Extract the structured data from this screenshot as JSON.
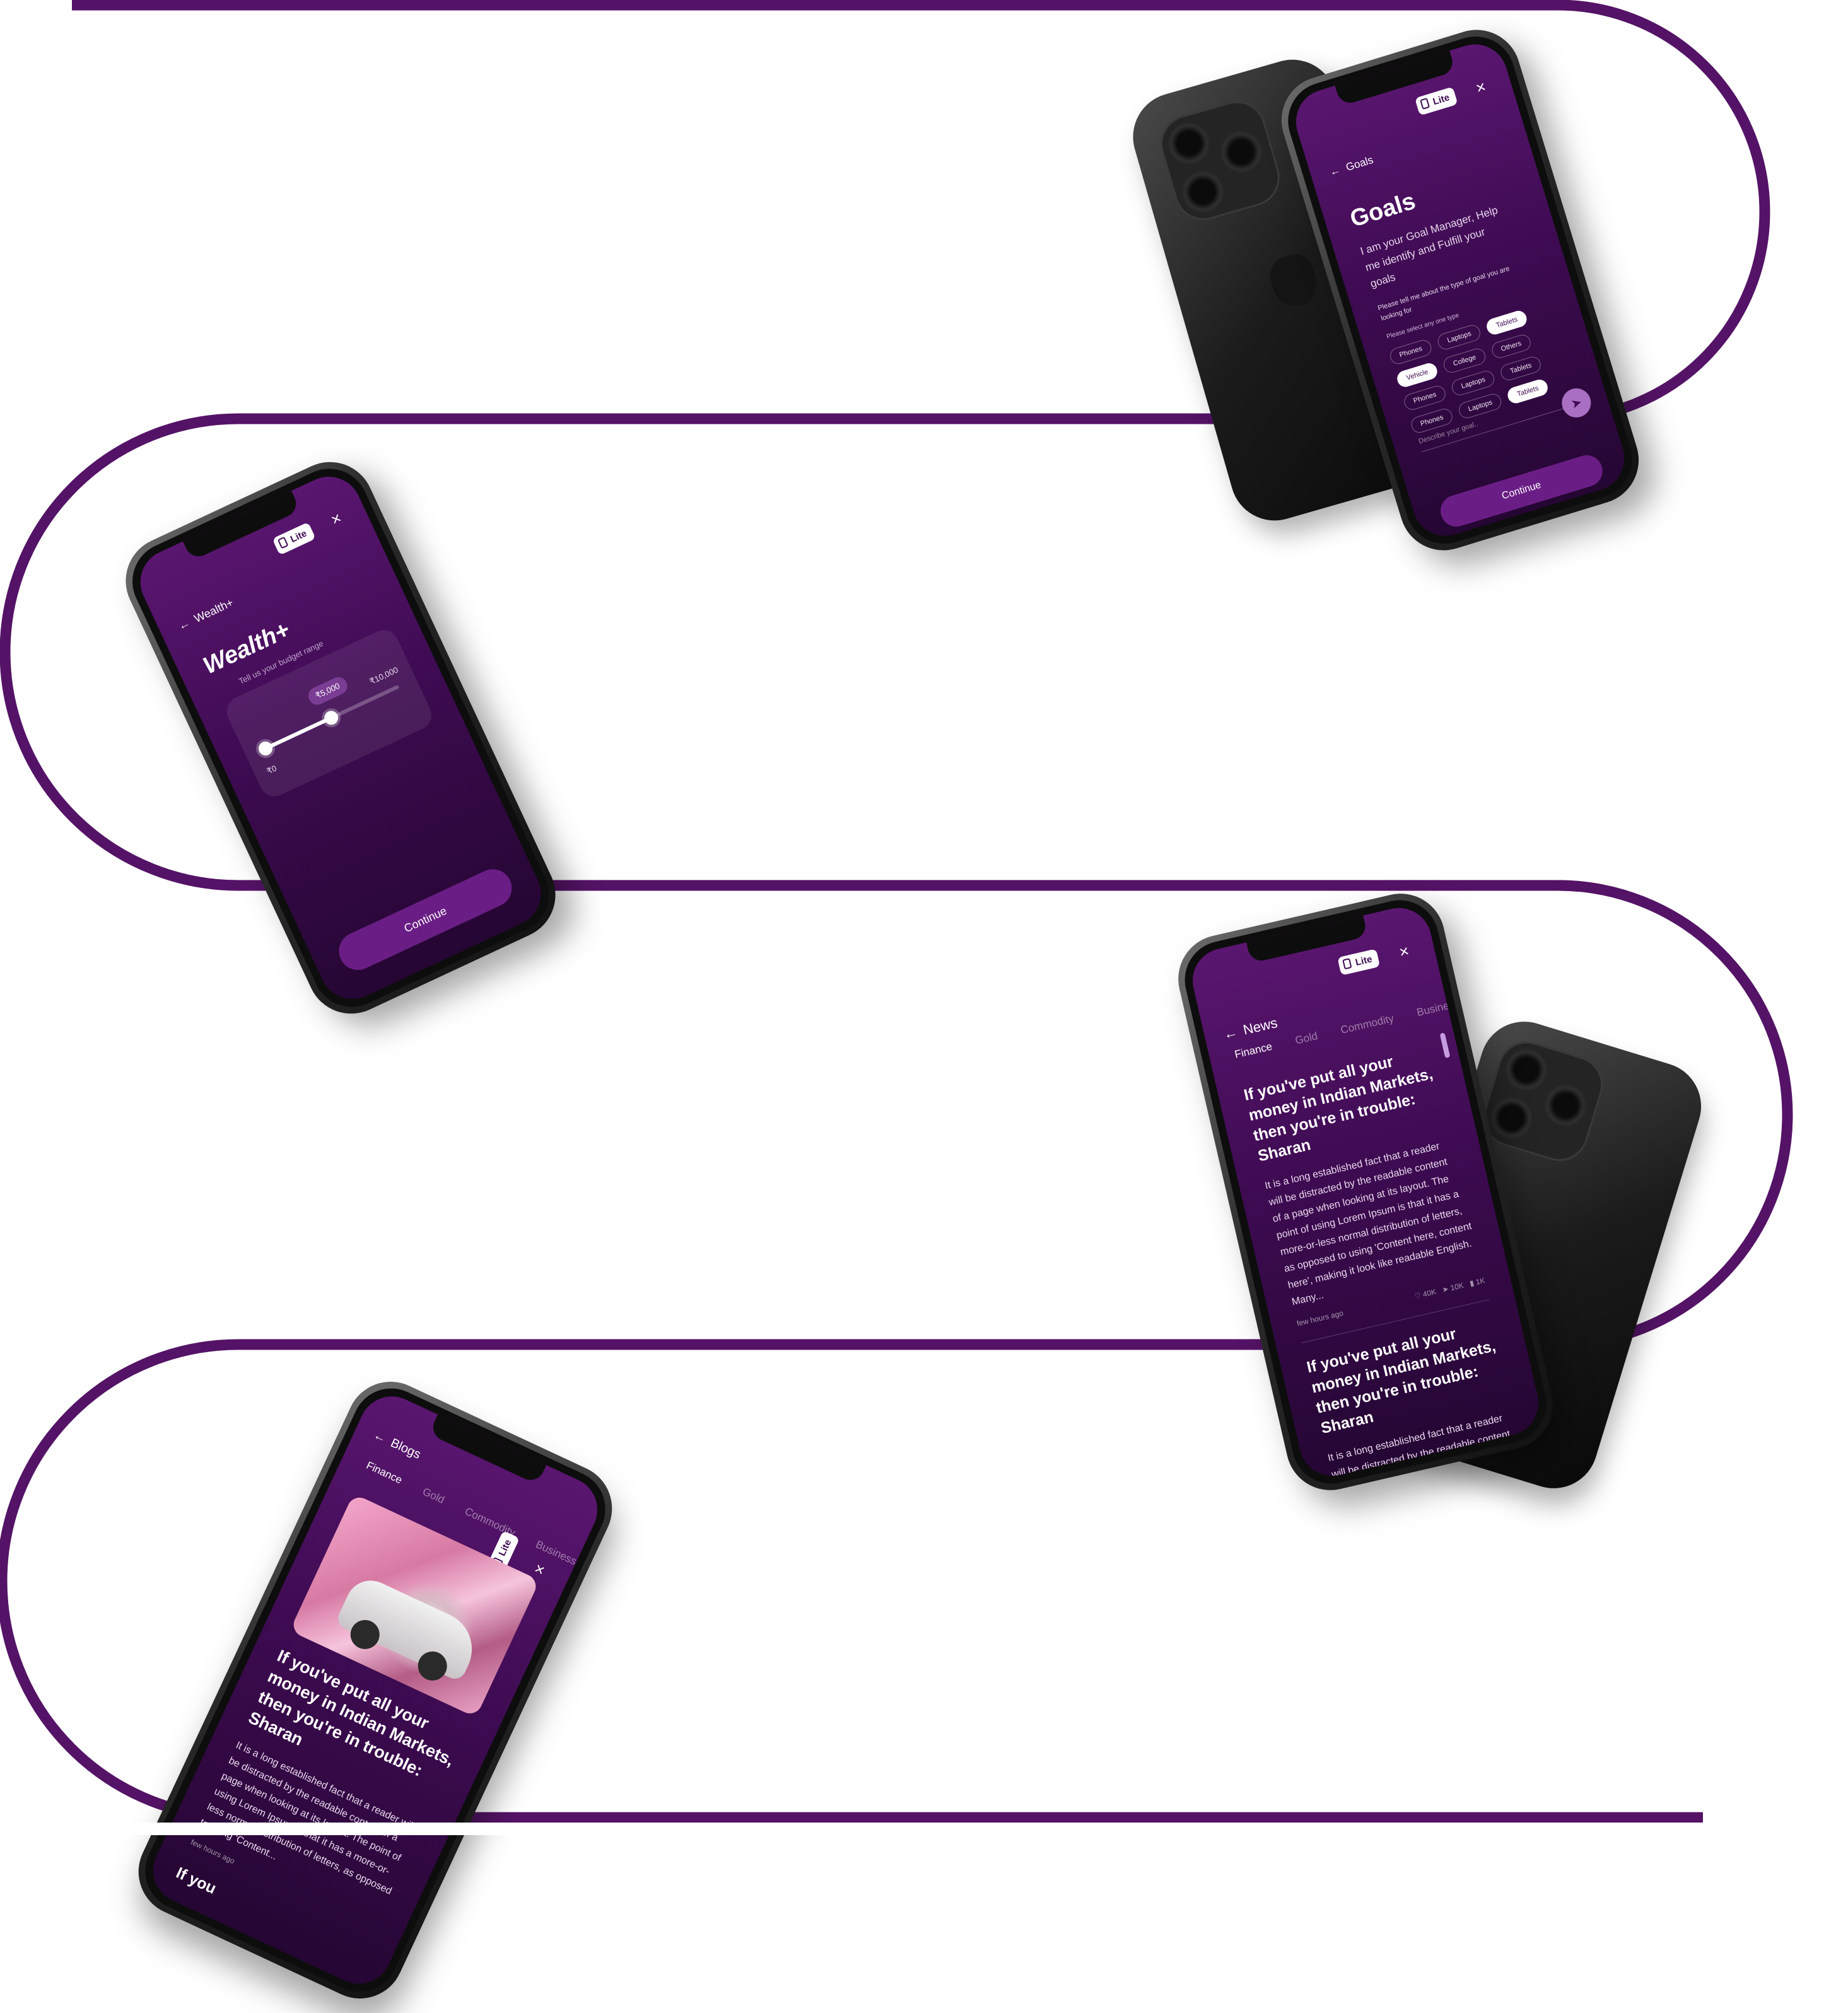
{
  "colors": {
    "track": "#541366",
    "screen_top": "#5a1670",
    "screen_bottom": "#250633",
    "accent": "#6a1e85"
  },
  "common": {
    "lite_label": "Lite",
    "close_glyph": "×",
    "back_glyph": "←",
    "continue_label": "Continue"
  },
  "goals": {
    "back_label": "Goals",
    "title": "Goals",
    "intro": "I am your Goal Manager, Help me identify and Fulfill your goals",
    "prompt": "Please tell me about the type of goal you are looking for",
    "select_hint": "Please select any one type",
    "chips": [
      {
        "label": "Phones",
        "selected": false
      },
      {
        "label": "Laptops",
        "selected": false
      },
      {
        "label": "Tablets",
        "selected": true
      },
      {
        "label": "Vehicle",
        "selected": true
      },
      {
        "label": "College",
        "selected": false
      },
      {
        "label": "Others",
        "selected": false
      },
      {
        "label": "Phones",
        "selected": false
      },
      {
        "label": "Laptops",
        "selected": false
      },
      {
        "label": "Tablets",
        "selected": false
      },
      {
        "label": "Phones",
        "selected": false
      },
      {
        "label": "Laptops",
        "selected": false
      },
      {
        "label": "Tablets",
        "selected": true
      }
    ],
    "describe_placeholder": "Describe your goal..",
    "continue_label": "Continue"
  },
  "wealth": {
    "back_label": "Wealth+",
    "title": "Wealth+",
    "subtitle": "Tell us your budget range",
    "slider": {
      "min_label": "₹0",
      "max_label": "₹10,000",
      "value_label": "₹5,000",
      "fraction": 0.5
    },
    "continue_label": "Continue"
  },
  "news": {
    "back_label": "News",
    "tabs": [
      "Finance",
      "Gold",
      "Commodity",
      "Business"
    ],
    "articles": [
      {
        "title": "If you've put all your money in Indian Markets, then you're in trouble: Sharan",
        "body": "It is a long established fact that a reader will be distracted by the readable content of a page when looking at its layout. The point of using Lorem Ipsum is that it has a more-or-less normal distribution of letters, as opposed to using 'Content here, content here', making it look like readable English. Many...",
        "time": "few hours ago",
        "likes": "40K",
        "shares": "10K",
        "saves": "1K"
      },
      {
        "title": "If you've put all your money in Indian Markets, then you're in trouble: Sharan",
        "body": "It is a long established fact that a reader will be distracted by the readable content of a page when looking at its layout. The point of using Lorem Ipsum..."
      }
    ]
  },
  "blogs": {
    "back_label": "Blogs",
    "tabs": [
      "Finance",
      "Gold",
      "Commodity",
      "Business"
    ],
    "article": {
      "title": "If you've put all your money in Indian Markets, then you're in trouble: Sharan",
      "body": "It is a long established fact that a reader will be distracted by the readable content of a page when looking at its layout. The point of using Lorem Ipsum is that it has a more-or-less normal distribution of letters, as opposed to using 'Content...",
      "time": "few hours ago"
    },
    "next_title_fragment": "If you"
  }
}
